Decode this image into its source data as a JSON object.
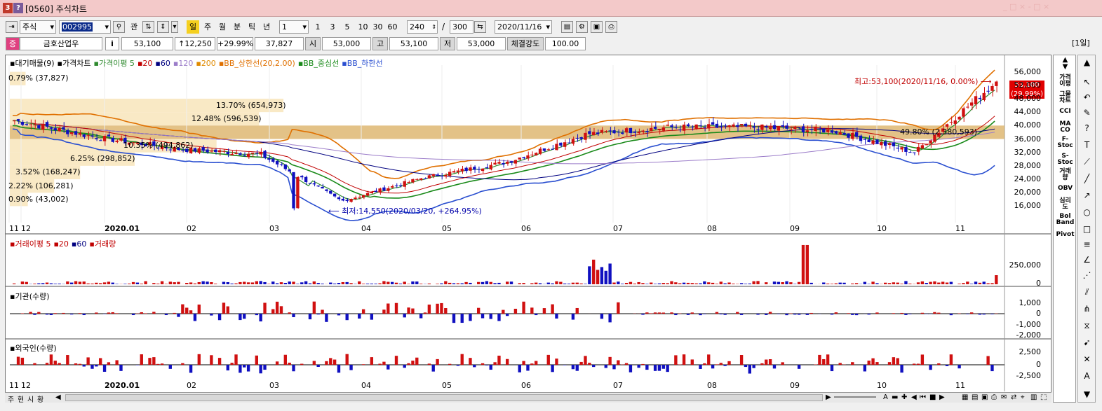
{
  "window": {
    "badge1": "3",
    "badge2": "?",
    "title": "[0560] 주식차트",
    "controls": "_ □ ×  - □ ×"
  },
  "toolbar": {
    "market": "주식",
    "code": "002995",
    "btn_gwan": "관",
    "periods": [
      "일",
      "주",
      "월",
      "분",
      "틱",
      "년"
    ],
    "period_value": "1",
    "intervals": [
      "1",
      "3",
      "5",
      "10",
      "30",
      "60"
    ],
    "count": "240",
    "total": "300",
    "date": "2020/11/16",
    "daily_label": "[1일]"
  },
  "quote": {
    "name": "금호산업우",
    "mark": "증",
    "info": "i",
    "price": "53,100",
    "change": "↑12,250",
    "pct": "+29.99%",
    "volume": "37,827",
    "open_label": "시",
    "open": "53,000",
    "high_label": "고",
    "high": "53,100",
    "low_label": "저",
    "low": "53,000",
    "strength_label": "체결강도",
    "strength": "100.00"
  },
  "price_pane": {
    "legend": [
      {
        "text": "대기매물(9)",
        "color": "#000000"
      },
      {
        "text": "가격차트",
        "color": "#000000"
      },
      {
        "text": "가격이평 5",
        "color": "#2f8a2f"
      },
      {
        "text": "20",
        "color": "#c00000"
      },
      {
        "text": "60",
        "color": "#000080"
      },
      {
        "text": "120",
        "color": "#9b7cc9"
      },
      {
        "text": "200",
        "color": "#e08a00"
      },
      {
        "text": "BB_상한선(20,2.00)",
        "color": "#e07000"
      },
      {
        "text": "BB_중심선",
        "color": "#1a8a1a"
      },
      {
        "text": "BB_하한선",
        "color": "#2a4fd0"
      }
    ],
    "y_ticks": [
      "56,000",
      "52,000",
      "48,000",
      "44,000",
      "40,000",
      "36,000",
      "32,000",
      "28,000",
      "24,000",
      "20,000",
      "16,000"
    ],
    "max_label": "최고:53,100(2020/11/16, 0.00%)",
    "min_label": "최저:14,550(2020/03/20, +264.95%)",
    "last_price": "53,100",
    "last_pct": "(29.99%)",
    "volume_profile": [
      {
        "text": "0.79% (37,827)"
      },
      {
        "text": "13.70% (654,973)"
      },
      {
        "text": "12.48% (596,539)"
      },
      {
        "text": "49.80% (2,380,593)"
      },
      {
        "text": "10.35% (494,862)"
      },
      {
        "text": "6.25% (298,852)"
      },
      {
        "text": "3.52% (168,247)"
      },
      {
        "text": "2.22% (106,281)"
      },
      {
        "text": "0.90% (43,002)"
      }
    ]
  },
  "volume_pane": {
    "legend": [
      {
        "text": "거래이평 5",
        "color": "#c00000"
      },
      {
        "text": "20",
        "color": "#c00000"
      },
      {
        "text": "60",
        "color": "#000080"
      },
      {
        "text": "거래량",
        "color": "#c00000"
      }
    ],
    "y_ticks": [
      "250,000",
      "0"
    ]
  },
  "inst_pane": {
    "legend": "기관(수량)",
    "y_ticks": [
      "1,000",
      "0",
      "-1,000",
      "-2,000"
    ]
  },
  "foreign_pane": {
    "legend": "외국인(수량)",
    "y_ticks": [
      "2,500",
      "0",
      "-2,500"
    ]
  },
  "x_labels": [
    "11",
    "12",
    "2020.01",
    "02",
    "03",
    "04",
    "05",
    "06",
    "07",
    "08",
    "09",
    "10",
    "11"
  ],
  "sidebar": [
    "가격\n이평",
    "그물\n차트",
    "CCI",
    "MA\nCO",
    "F-\nStoc",
    "S-\nStoc",
    "거래\n량",
    "OBV",
    "심리\n도",
    "Bol\nBand",
    "Pivot"
  ],
  "bottom": {
    "tabs": [
      "주",
      "현",
      "시",
      "황"
    ]
  },
  "chart_data": {
    "type": "candlestick",
    "x": [
      "2019-11",
      "2019-12",
      "2020-01",
      "2020-02",
      "2020-03",
      "2020-04",
      "2020-05",
      "2020-06",
      "2020-07",
      "2020-08",
      "2020-09",
      "2020-10",
      "2020-11"
    ],
    "close_approx": [
      41500,
      36500,
      33000,
      31500,
      17500,
      24500,
      29000,
      37500,
      39500,
      39500,
      38500,
      32000,
      53100
    ],
    "ylim": [
      14000,
      58000
    ],
    "max": {
      "value": 53100,
      "date": "2020/11/16"
    },
    "min": {
      "value": 14550,
      "date": "2020/03/20"
    },
    "volume_profile": {
      "ranges": [
        [
          52000,
          56000
        ],
        [
          44000,
          48000
        ],
        [
          40000,
          44000
        ],
        [
          36000,
          40000
        ],
        [
          32000,
          36000
        ],
        [
          28000,
          32000
        ],
        [
          24000,
          28000
        ],
        [
          20000,
          24000
        ],
        [
          16000,
          20000
        ]
      ],
      "pct": [
        0.79,
        13.7,
        12.48,
        49.8,
        10.35,
        6.25,
        3.52,
        2.22,
        0.9
      ],
      "qty": [
        37827,
        654973,
        596539,
        2380593,
        494862,
        298852,
        168247,
        106281,
        43002
      ]
    }
  }
}
